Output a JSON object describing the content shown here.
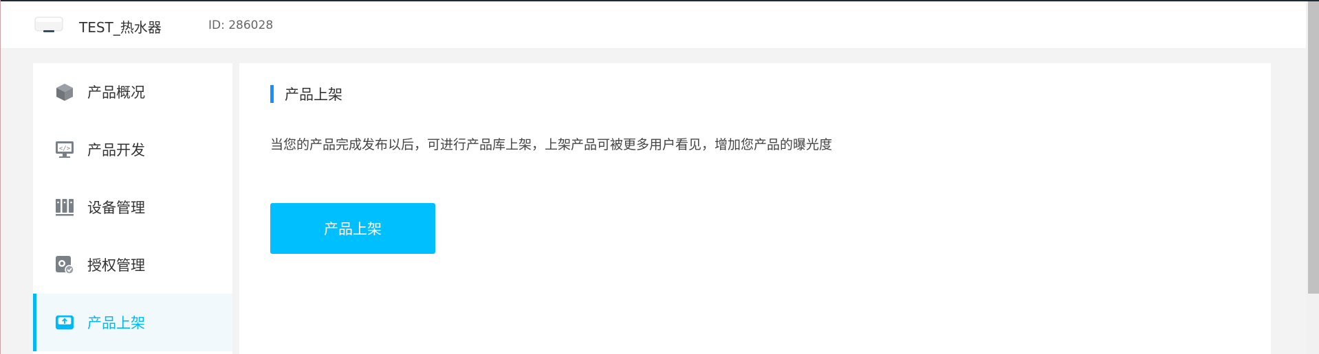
{
  "header": {
    "product_name": "TEST_热水器",
    "product_id": "ID: 286028"
  },
  "sidebar": {
    "items": [
      {
        "label": "产品概况",
        "icon": "cube-icon",
        "active": false
      },
      {
        "label": "产品开发",
        "icon": "monitor-code-icon",
        "active": false
      },
      {
        "label": "设备管理",
        "icon": "devices-icon",
        "active": false
      },
      {
        "label": "授权管理",
        "icon": "license-check-icon",
        "active": false
      },
      {
        "label": "产品上架",
        "icon": "inbox-upload-icon",
        "active": true
      }
    ]
  },
  "main": {
    "section_title": "产品上架",
    "description": "当您的产品完成发布以后，可进行产品库上架，上架产品可被更多用户看见，增加您产品的曝光度",
    "publish_button": "产品上架"
  },
  "colors": {
    "accent": "#00b9f5",
    "title_bar": "#1890ff",
    "button": "#00bfff"
  }
}
